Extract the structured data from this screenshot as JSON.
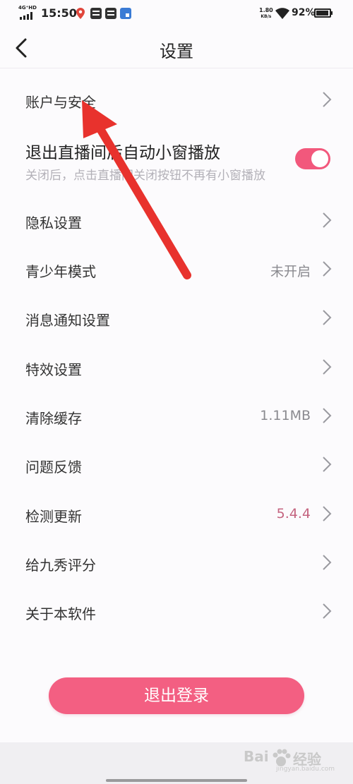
{
  "status_bar": {
    "network": "4G⁺HD",
    "time": "15:50",
    "speed_value": "1.80",
    "speed_unit": "KB/s",
    "battery": "92%",
    "battery_level": 0.92
  },
  "header": {
    "title": "设置"
  },
  "settings": {
    "account": {
      "label": "账户与安全"
    },
    "mini_window": {
      "label": "退出直播间后自动小窗播放",
      "description": "关闭后，点击直播间关闭按钮不再有小窗播放",
      "enabled": true
    },
    "privacy": {
      "label": "隐私设置"
    },
    "youth_mode": {
      "label": "青少年模式",
      "value": "未开启"
    },
    "notifications": {
      "label": "消息通知设置"
    },
    "effects": {
      "label": "特效设置"
    },
    "clear_cache": {
      "label": "清除缓存",
      "value": "1.11MB"
    },
    "feedback": {
      "label": "问题反馈"
    },
    "check_update": {
      "label": "检测更新",
      "value": "5.4.4"
    },
    "rate_app": {
      "label": "给九秀评分"
    },
    "about": {
      "label": "关于本软件"
    }
  },
  "logout_label": "退出登录",
  "colors": {
    "accent": "#f35f82",
    "toggle_on": "#f2587c",
    "version_text": "#c4637f",
    "annotation_arrow": "#e8322d"
  },
  "watermark": {
    "brand_left": "Bai",
    "brand_right": "经验",
    "domain": "jingyan.baidu.com"
  }
}
